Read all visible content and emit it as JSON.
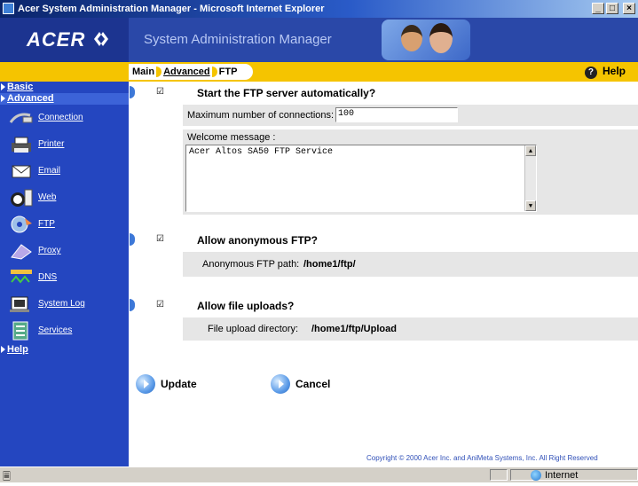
{
  "window": {
    "title": "Acer System Administration Manager - Microsoft Internet Explorer",
    "controls": [
      "_",
      "□",
      "×"
    ]
  },
  "header": {
    "logo": "ACER",
    "app_title": "System Administration Manager"
  },
  "breadcrumb": {
    "main": "Main",
    "advanced": "Advanced",
    "current": "FTP"
  },
  "help_label": "Help",
  "sidebar": {
    "basic": "Basic",
    "advanced": "Advanced",
    "help": "Help",
    "items": [
      {
        "label": "Connection",
        "icon": "cable-icon"
      },
      {
        "label": "Printer",
        "icon": "printer-icon"
      },
      {
        "label": "Email",
        "icon": "envelope-icon"
      },
      {
        "label": "Web",
        "icon": "web-globe-icon"
      },
      {
        "label": "FTP",
        "icon": "ftp-disc-icon"
      },
      {
        "label": "Proxy",
        "icon": "proxy-icon"
      },
      {
        "label": "DNS",
        "icon": "dns-icon"
      },
      {
        "label": "System Log",
        "icon": "system-log-icon"
      },
      {
        "label": "Services",
        "icon": "services-icon"
      }
    ]
  },
  "form": {
    "auto_start": {
      "label": "Start the FTP server automatically?",
      "checked": true
    },
    "max_connections": {
      "label": "Maximum number of connections:",
      "value": "100"
    },
    "welcome": {
      "label": "Welcome message :",
      "value": "Acer Altos SA50 FTP Service"
    },
    "anonymous": {
      "label": "Allow anonymous FTP?",
      "checked": true
    },
    "anon_path": {
      "label": "Anonymous FTP path:",
      "value": "/home1/ftp/"
    },
    "uploads": {
      "label": "Allow file uploads?",
      "checked": true
    },
    "upload_dir": {
      "label": "File upload directory:",
      "value": "/home1/ftp/Upload"
    }
  },
  "actions": {
    "update": "Update",
    "cancel": "Cancel"
  },
  "copyright": "Copyright © 2000   Acer Inc. and AniMeta Systems, Inc.  All Right Reserved",
  "status": {
    "zone": "Internet"
  },
  "colors": {
    "accent": "#2446c0",
    "bar": "#f5c400",
    "row": "#e6e6e6"
  }
}
